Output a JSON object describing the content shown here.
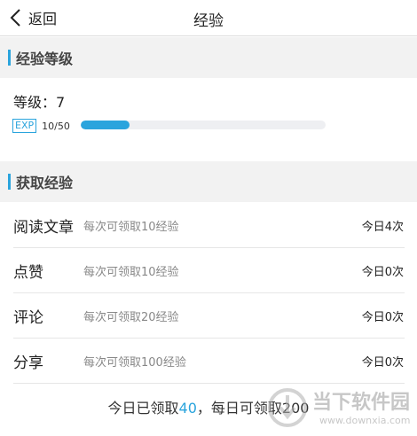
{
  "header": {
    "back_label": "返回",
    "title": "经验"
  },
  "level_section": {
    "title": "经验等级",
    "level_text": "等级：7",
    "exp_badge": "EXP",
    "exp_count": "10/50",
    "progress_fraction": 0.2,
    "accent_color": "#2aa4dd"
  },
  "earn_section": {
    "title": "获取经验",
    "tasks": [
      {
        "name": "阅读文章",
        "desc": "每次可领取10经验",
        "status": "今日4次"
      },
      {
        "name": "点赞",
        "desc": "每次可领取10经验",
        "status": "今日0次"
      },
      {
        "name": "评论",
        "desc": "每次可领取20经验",
        "status": "今日0次"
      },
      {
        "name": "分享",
        "desc": "每次可领取100经验",
        "status": "今日0次"
      }
    ]
  },
  "summary": {
    "prefix": "今日已领取",
    "claimed": "40",
    "middle": "，每日可领取",
    "daily_max": "200"
  },
  "watermark": {
    "brand": "当下软件园",
    "url": "www.downxia.com"
  },
  "icons": {
    "back": "chevron-left-icon",
    "logo": "downxia-logo-icon"
  }
}
